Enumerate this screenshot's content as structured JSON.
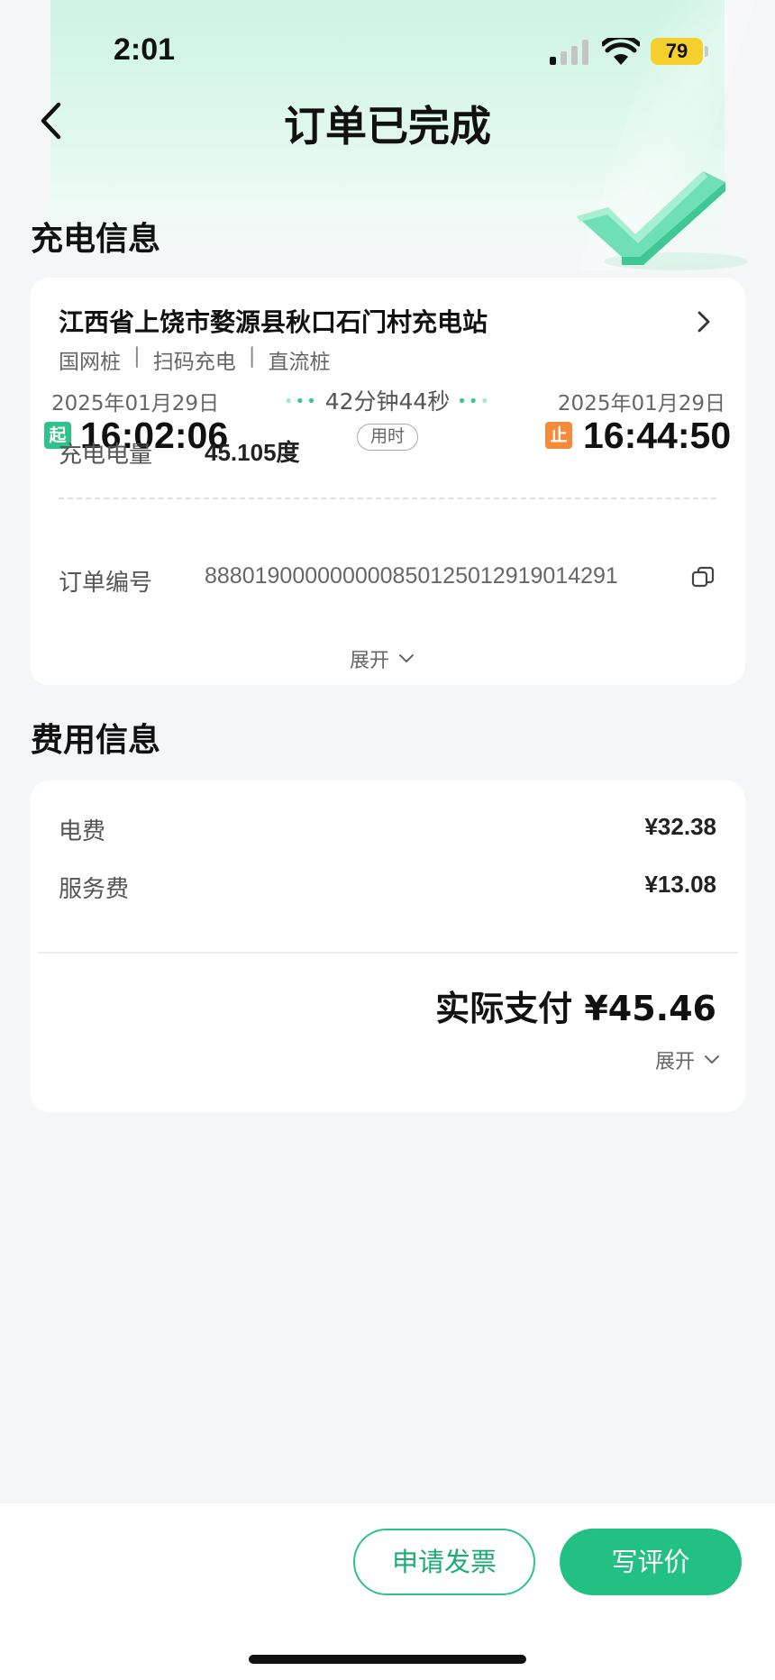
{
  "status_bar": {
    "time": "2:01",
    "battery": "79"
  },
  "nav": {
    "title": "订单已完成"
  },
  "charging_section": {
    "title": "充电信息",
    "station_name": "江西省上饶市婺源县秋口石门村充电站",
    "tags": [
      "国网桩",
      "扫码充电",
      "直流桩"
    ],
    "tag_separator": "|",
    "start_date": "2025年01月29日",
    "end_date": "2025年01月29日",
    "duration": "42分钟44秒",
    "duration_label": "用时",
    "start_tag": "起",
    "end_tag": "止",
    "start_time": "16:02:06",
    "end_time": "16:44:50",
    "energy_label": "充电电量",
    "energy_value": "45.105度",
    "order_label": "订单编号",
    "order_value": "888019000000000850125012919014291",
    "expand_label": "展开"
  },
  "fee_section": {
    "title": "费用信息",
    "items": [
      {
        "label": "电费",
        "value": "¥32.38"
      },
      {
        "label": "服务费",
        "value": "¥13.08"
      }
    ],
    "total": "实际支付 ¥45.46",
    "expand_label": "展开"
  },
  "actions": {
    "invoice_label": "申请发票",
    "review_label": "写评价"
  },
  "colors": {
    "accent": "#23c083",
    "start": "#2fc28a",
    "end": "#f58a3b",
    "battery": "#f5d02c"
  }
}
